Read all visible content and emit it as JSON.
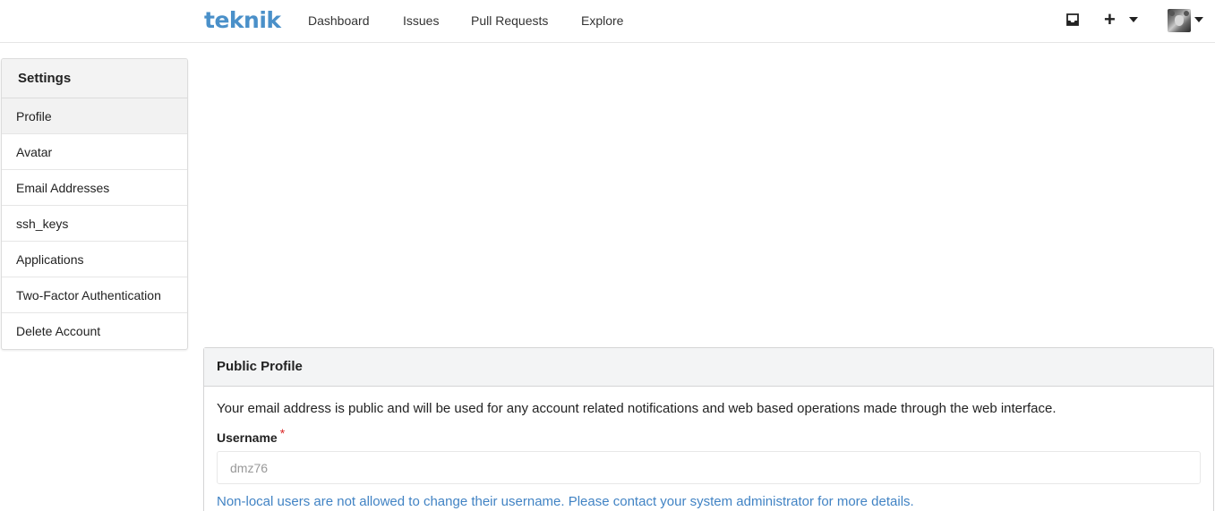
{
  "header": {
    "logo_text": "teknik",
    "nav": [
      "Dashboard",
      "Issues",
      "Pull Requests",
      "Explore"
    ],
    "icons": [
      "inbox-icon",
      "plus-icon",
      "caret-down-icon",
      "avatar",
      "caret-down-icon"
    ]
  },
  "sidebar": {
    "title": "Settings",
    "items": [
      {
        "label": "Profile",
        "active": true
      },
      {
        "label": "Avatar"
      },
      {
        "label": "Email Addresses"
      },
      {
        "label": "ssh_keys"
      },
      {
        "label": "Applications"
      },
      {
        "label": "Two-Factor Authentication"
      },
      {
        "label": "Delete Account"
      }
    ]
  },
  "main": {
    "panel_title": "Public Profile",
    "notice": "Your email address is public and will be used for any account related notifications and web based operations made through the web interface.",
    "username_label": "Username",
    "required_mark": "*",
    "username_value": "dmz76",
    "help_text": "Non-local users are not allowed to change their username. Please contact your system administrator for more details."
  },
  "colors": {
    "logo": "#4a90c9",
    "link": "#4183c4",
    "required": "#db2828"
  }
}
